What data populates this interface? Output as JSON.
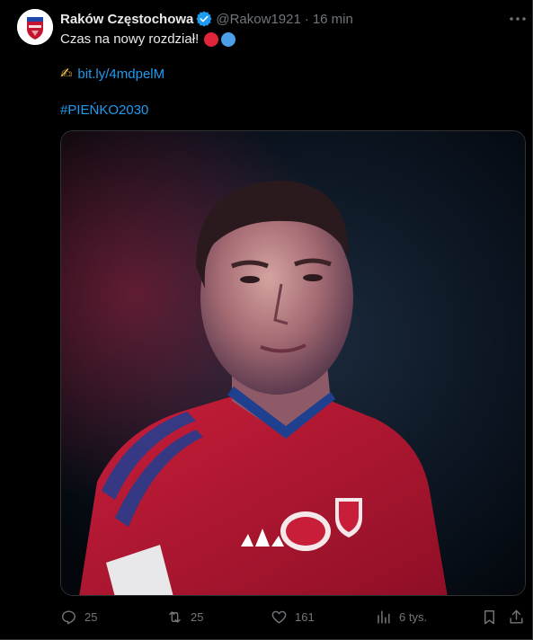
{
  "tweet": {
    "display_name": "Raków Częstochowa",
    "handle": "@Rakow1921",
    "separator": "·",
    "time": "16 min",
    "text": "Czas na nowy rozdział!",
    "link_emoji": "✍",
    "link": "bit.ly/4mdpelM",
    "hashtag": "#PIEŃKO2030"
  },
  "colors": {
    "link": "#1d9bf0",
    "circle_red": "#e0243a",
    "circle_blue": "#4a9fe8",
    "verified": "#1d9bf0",
    "muted": "#71767b"
  },
  "actions": {
    "replies": "25",
    "reposts": "25",
    "likes": "161",
    "views": "6 tys."
  },
  "icons": [
    "verified-badge-icon",
    "more-icon",
    "reply-icon",
    "repost-icon",
    "like-icon",
    "views-icon",
    "bookmark-icon",
    "share-icon"
  ]
}
